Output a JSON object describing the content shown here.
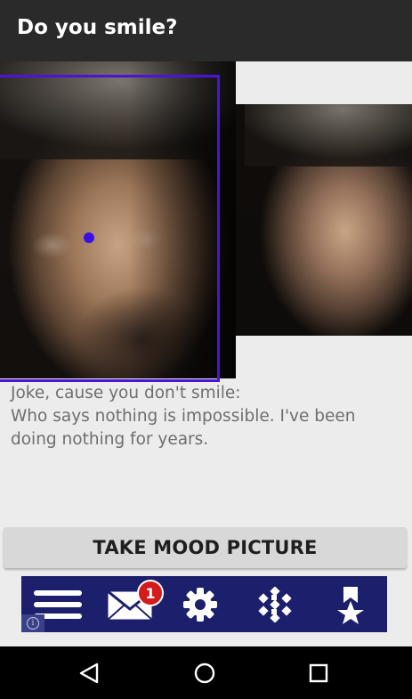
{
  "appbar": {
    "title": "Do you smile?"
  },
  "joke": {
    "line1": "Joke, cause you don't smile:",
    "line2": "Who says nothing is impossible. I've been doing nothing for years."
  },
  "mood_button": {
    "label": "TAKE MOOD PICTURE"
  },
  "ad_bar": {
    "icons": [
      "menu-icon",
      "mail-icon",
      "gear-icon",
      "grid-icon",
      "bookmark-star-icon",
      "info-icon"
    ],
    "mail_badge": "1",
    "colors": {
      "background": "#1b1f6c",
      "badge": "#d21b1b"
    }
  },
  "navbar": {
    "icons": [
      "back-icon",
      "home-icon",
      "recents-icon"
    ]
  },
  "colors": {
    "appbar": "#2a2a2a",
    "face_box": "#4a14d9",
    "page_bg": "#ececec"
  }
}
